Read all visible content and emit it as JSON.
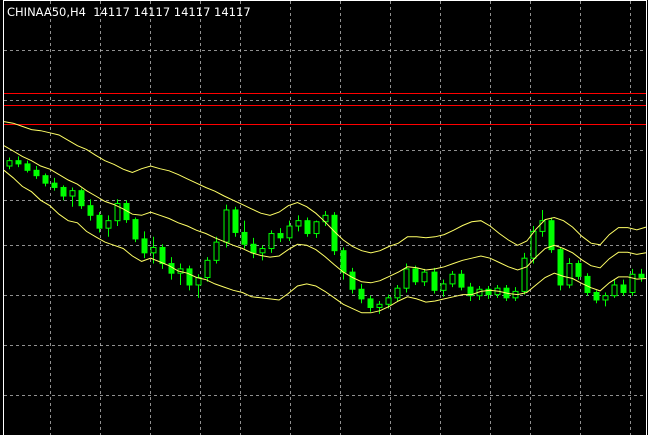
{
  "header": {
    "symbol": "CHINAA50,H4",
    "prices": [
      "14117",
      "14117",
      "14117",
      "14117"
    ]
  },
  "colors": {
    "background": "#000000",
    "frame": "#ffffff",
    "grid": "#c0c0c0",
    "level_line": "#ff0000",
    "band": "#ffff66",
    "candle": "#00ff00"
  },
  "chart_data": {
    "type": "line",
    "price_range": [
      13750,
      14560
    ],
    "grid": true,
    "horizontal_levels": [
      14388,
      14366,
      14330
    ],
    "series": [
      {
        "values": [
          14335,
          14332,
          14326,
          14320,
          14318,
          14314,
          14310,
          14300,
          14290,
          14283,
          14272,
          14262,
          14255,
          14246,
          14240,
          14247,
          14252,
          14247,
          14243,
          14236,
          14228,
          14220,
          14212,
          14205,
          14196,
          14188,
          14180,
          14172,
          14164,
          14160,
          14166,
          14178,
          14184,
          14176,
          14164,
          14148,
          14130,
          14114,
          14102,
          14094,
          14090,
          14094,
          14102,
          14108,
          14120,
          14120,
          14118,
          14120,
          14124,
          14132,
          14141,
          14148,
          14150,
          14140,
          14126,
          14114,
          14104,
          14112,
          14134,
          14152,
          14156,
          14150,
          14138,
          14121,
          14108,
          14105,
          14124,
          14137,
          14137,
          14133,
          14138
        ]
      },
      {
        "values": [
          14290,
          14280,
          14270,
          14262,
          14252,
          14246,
          14236,
          14226,
          14218,
          14206,
          14196,
          14186,
          14180,
          14172,
          14162,
          14160,
          14166,
          14160,
          14154,
          14146,
          14140,
          14132,
          14126,
          14118,
          14111,
          14104,
          14098,
          14090,
          14085,
          14082,
          14084,
          14096,
          14106,
          14104,
          14096,
          14083,
          14068,
          14054,
          14044,
          14036,
          14034,
          14038,
          14046,
          14054,
          14064,
          14062,
          14058,
          14060,
          14064,
          14070,
          14076,
          14080,
          14084,
          14080,
          14072,
          14064,
          14058,
          14064,
          14082,
          14098,
          14104,
          14098,
          14090,
          14077,
          14066,
          14062,
          14079,
          14091,
          14091,
          14087,
          14090
        ]
      },
      {
        "values": [
          14244,
          14230,
          14214,
          14204,
          14188,
          14178,
          14162,
          14150,
          14146,
          14130,
          14120,
          14110,
          14104,
          14098,
          14084,
          14074,
          14080,
          14073,
          14066,
          14056,
          14052,
          14044,
          14040,
          14032,
          14026,
          14020,
          14016,
          14008,
          14006,
          14004,
          14002,
          14014,
          14028,
          14032,
          14028,
          14018,
          14006,
          13994,
          13986,
          13978,
          13978,
          13982,
          13990,
          14000,
          14008,
          14004,
          13998,
          14000,
          14004,
          14008,
          14012,
          14012,
          14018,
          14020,
          14018,
          14014,
          14012,
          14016,
          14030,
          14044,
          14052,
          14046,
          14042,
          14033,
          14025,
          14019,
          14034,
          14045,
          14045,
          14041,
          14042
        ]
      }
    ],
    "candles": [
      {
        "o": 14252,
        "h": 14268,
        "l": 14246,
        "c": 14262
      },
      {
        "o": 14262,
        "h": 14270,
        "l": 14250,
        "c": 14256
      },
      {
        "o": 14256,
        "h": 14262,
        "l": 14240,
        "c": 14244
      },
      {
        "o": 14244,
        "h": 14252,
        "l": 14228,
        "c": 14234
      },
      {
        "o": 14234,
        "h": 14238,
        "l": 14214,
        "c": 14220
      },
      {
        "o": 14220,
        "h": 14230,
        "l": 14206,
        "c": 14212
      },
      {
        "o": 14212,
        "h": 14216,
        "l": 14188,
        "c": 14196
      },
      {
        "o": 14196,
        "h": 14212,
        "l": 14176,
        "c": 14206
      },
      {
        "o": 14206,
        "h": 14210,
        "l": 14172,
        "c": 14178
      },
      {
        "o": 14178,
        "h": 14190,
        "l": 14150,
        "c": 14160
      },
      {
        "o": 14160,
        "h": 14166,
        "l": 14128,
        "c": 14136
      },
      {
        "o": 14136,
        "h": 14160,
        "l": 14120,
        "c": 14150
      },
      {
        "o": 14150,
        "h": 14190,
        "l": 14140,
        "c": 14182
      },
      {
        "o": 14182,
        "h": 14188,
        "l": 14146,
        "c": 14152
      },
      {
        "o": 14152,
        "h": 14156,
        "l": 14110,
        "c": 14116
      },
      {
        "o": 14116,
        "h": 14130,
        "l": 14080,
        "c": 14090
      },
      {
        "o": 14090,
        "h": 14120,
        "l": 14070,
        "c": 14100
      },
      {
        "o": 14100,
        "h": 14106,
        "l": 14060,
        "c": 14070
      },
      {
        "o": 14070,
        "h": 14082,
        "l": 14040,
        "c": 14052
      },
      {
        "o": 14052,
        "h": 14070,
        "l": 14030,
        "c": 14060
      },
      {
        "o": 14060,
        "h": 14066,
        "l": 14020,
        "c": 14030
      },
      {
        "o": 14030,
        "h": 14050,
        "l": 14006,
        "c": 14044
      },
      {
        "o": 14044,
        "h": 14082,
        "l": 14036,
        "c": 14076
      },
      {
        "o": 14076,
        "h": 14120,
        "l": 14070,
        "c": 14110
      },
      {
        "o": 14110,
        "h": 14180,
        "l": 14100,
        "c": 14170
      },
      {
        "o": 14170,
        "h": 14176,
        "l": 14120,
        "c": 14128
      },
      {
        "o": 14128,
        "h": 14150,
        "l": 14098,
        "c": 14106
      },
      {
        "o": 14106,
        "h": 14118,
        "l": 14080,
        "c": 14090
      },
      {
        "o": 14090,
        "h": 14104,
        "l": 14076,
        "c": 14098
      },
      {
        "o": 14098,
        "h": 14132,
        "l": 14090,
        "c": 14126
      },
      {
        "o": 14126,
        "h": 14136,
        "l": 14110,
        "c": 14118
      },
      {
        "o": 14118,
        "h": 14150,
        "l": 14112,
        "c": 14140
      },
      {
        "o": 14140,
        "h": 14160,
        "l": 14130,
        "c": 14150
      },
      {
        "o": 14150,
        "h": 14156,
        "l": 14120,
        "c": 14126
      },
      {
        "o": 14126,
        "h": 14150,
        "l": 14118,
        "c": 14148
      },
      {
        "o": 14148,
        "h": 14168,
        "l": 14140,
        "c": 14160
      },
      {
        "o": 14160,
        "h": 14166,
        "l": 14086,
        "c": 14094
      },
      {
        "o": 14094,
        "h": 14100,
        "l": 14040,
        "c": 14054
      },
      {
        "o": 14054,
        "h": 14062,
        "l": 14014,
        "c": 14022
      },
      {
        "o": 14022,
        "h": 14032,
        "l": 13996,
        "c": 14004
      },
      {
        "o": 14004,
        "h": 14010,
        "l": 13980,
        "c": 13988
      },
      {
        "o": 13988,
        "h": 14000,
        "l": 13976,
        "c": 13994
      },
      {
        "o": 13994,
        "h": 14012,
        "l": 13986,
        "c": 14006
      },
      {
        "o": 14006,
        "h": 14030,
        "l": 14000,
        "c": 14024
      },
      {
        "o": 14024,
        "h": 14070,
        "l": 14016,
        "c": 14060
      },
      {
        "o": 14060,
        "h": 14066,
        "l": 14030,
        "c": 14036
      },
      {
        "o": 14036,
        "h": 14060,
        "l": 14028,
        "c": 14054
      },
      {
        "o": 14054,
        "h": 14062,
        "l": 14014,
        "c": 14020
      },
      {
        "o": 14020,
        "h": 14040,
        "l": 14008,
        "c": 14032
      },
      {
        "o": 14032,
        "h": 14056,
        "l": 14026,
        "c": 14050
      },
      {
        "o": 14050,
        "h": 14058,
        "l": 14020,
        "c": 14026
      },
      {
        "o": 14026,
        "h": 14034,
        "l": 14000,
        "c": 14010
      },
      {
        "o": 14010,
        "h": 14028,
        "l": 14002,
        "c": 14022
      },
      {
        "o": 14022,
        "h": 14028,
        "l": 14004,
        "c": 14012
      },
      {
        "o": 14012,
        "h": 14030,
        "l": 14006,
        "c": 14024
      },
      {
        "o": 14024,
        "h": 14030,
        "l": 14000,
        "c": 14006
      },
      {
        "o": 14006,
        "h": 14026,
        "l": 14000,
        "c": 14018
      },
      {
        "o": 14018,
        "h": 14090,
        "l": 14012,
        "c": 14080
      },
      {
        "o": 14080,
        "h": 14140,
        "l": 14070,
        "c": 14130
      },
      {
        "o": 14130,
        "h": 14170,
        "l": 14120,
        "c": 14150
      },
      {
        "o": 14150,
        "h": 14156,
        "l": 14090,
        "c": 14096
      },
      {
        "o": 14096,
        "h": 14100,
        "l": 14020,
        "c": 14030
      },
      {
        "o": 14030,
        "h": 14080,
        "l": 14024,
        "c": 14070
      },
      {
        "o": 14070,
        "h": 14076,
        "l": 14040,
        "c": 14046
      },
      {
        "o": 14046,
        "h": 14052,
        "l": 14010,
        "c": 14016
      },
      {
        "o": 14016,
        "h": 14020,
        "l": 13996,
        "c": 14002
      },
      {
        "o": 14002,
        "h": 14016,
        "l": 13990,
        "c": 14010
      },
      {
        "o": 14010,
        "h": 14040,
        "l": 14006,
        "c": 14030
      },
      {
        "o": 14030,
        "h": 14040,
        "l": 14010,
        "c": 14016
      },
      {
        "o": 14016,
        "h": 14060,
        "l": 14010,
        "c": 14050
      },
      {
        "o": 14050,
        "h": 14060,
        "l": 14036,
        "c": 14044
      }
    ]
  }
}
